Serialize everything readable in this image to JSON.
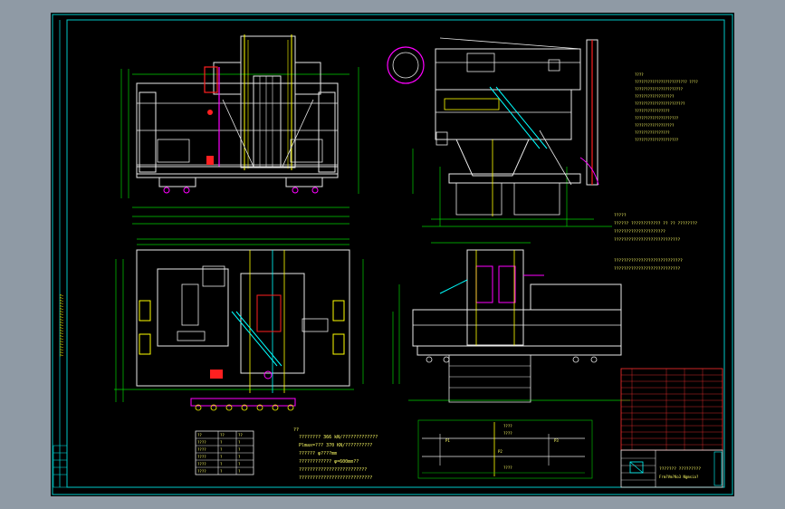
{
  "colors": {
    "background": "#8f9aa5",
    "sheet": "#000000",
    "frame": "#00c8c8",
    "structure": "#e8e8e8",
    "dimension": "#00d000",
    "accent_yellow": "#ffff00",
    "accent_red": "#ff2020",
    "accent_magenta": "#ff00ff",
    "accent_cyan": "#00ffff",
    "text_yellow": "#ffff66",
    "table_red": "#ff3030"
  },
  "sheet_info": {
    "left_strip_text": "???????????????????????"
  },
  "notes_upper": [
    "????",
    "???????????????????????? ????",
    "??????????????????????",
    "??????????????????",
    "???????????????????????",
    "????????????????",
    "????????????????????",
    "??????????????????",
    "????????????????",
    "????????????????????"
  ],
  "notes_middle": [
    "?????",
    "?????? ???????????? ?? ?? ????????",
    "?????????????????????",
    "???????????????????????????",
    "????????????????????????????",
    "???????????????????????????"
  ],
  "notes_lower": [
    "??",
    "???????? 366 kN/?????????????",
    "Plmax=??? 370 KN/??????????",
    "?????? φ????mm",
    "???????????? φ=600mm??",
    "?????????????????????????",
    "???????????????????????????"
  ],
  "spec_table": {
    "rows": [
      [
        "??",
        "??",
        "??"
      ],
      [
        "????",
        "?",
        "?"
      ],
      [
        "????",
        "?",
        "?"
      ],
      [
        "????",
        "?",
        "?"
      ],
      [
        "????",
        "?",
        "?"
      ],
      [
        "????",
        "?",
        "?"
      ]
    ]
  },
  "lines_diagram": {
    "labels": [
      "????",
      "????",
      "P1",
      "P2",
      "P3",
      "????"
    ]
  },
  "title_block": {
    "title_line1": "??????? ?????????",
    "title_line2": "Frm?Vm?Ko3 Ngmsia?"
  }
}
